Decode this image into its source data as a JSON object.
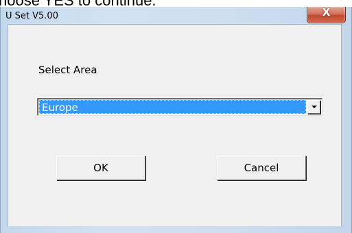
{
  "background_text": "hoose YES to continue.",
  "window": {
    "title": "U Set V5.00",
    "close_glyph": "X"
  },
  "dialog": {
    "label": "Select Area",
    "area_select": {
      "selected": "Europe"
    },
    "ok_label": "OK",
    "cancel_label": "Cancel"
  },
  "colors": {
    "selection": "#3399ff",
    "close_button": "#c2472e",
    "client_background": "#f0f0f0"
  }
}
